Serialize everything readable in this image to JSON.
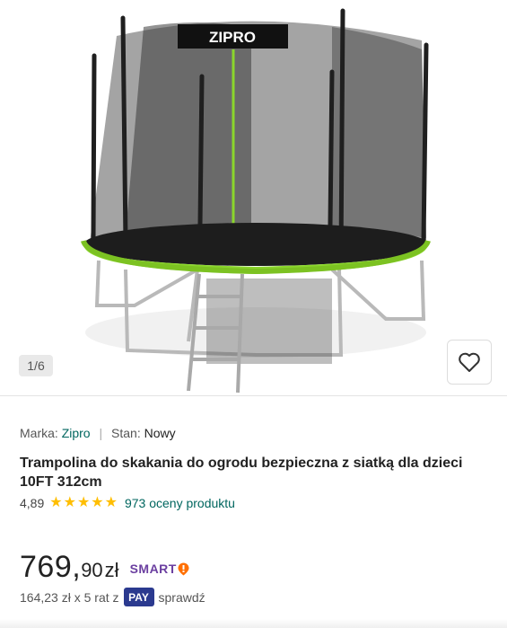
{
  "gallery": {
    "counter": "1/6",
    "image_brand_label": "ZIPRO"
  },
  "meta": {
    "brand_label": "Marka:",
    "brand_value": "Zipro",
    "condition_label": "Stan:",
    "condition_value": "Nowy"
  },
  "product": {
    "title": "Trampolina do skakania do ogrodu bezpieczna z siatką dla dzieci 10FT 312cm"
  },
  "rating": {
    "value": "4,89",
    "stars": 5,
    "count_text": "973 oceny produktu"
  },
  "price": {
    "main": "769,",
    "cents": "90",
    "currency": "zł",
    "smart_label": "SMART"
  },
  "installments": {
    "text": "164,23 zł x 5 rat z",
    "pay_label": "PAY",
    "check_label": "sprawdź"
  },
  "colors": {
    "link": "#00665f",
    "star": "#ffbe00",
    "smart": "#6b3fa0",
    "smart_accent": "#ff6f00",
    "pay": "#2b3a8f",
    "trampoline_green": "#8bd62c"
  },
  "icons": {
    "favorite": "heart-icon",
    "smart": "smart-badge-icon",
    "star": "star-icon"
  }
}
